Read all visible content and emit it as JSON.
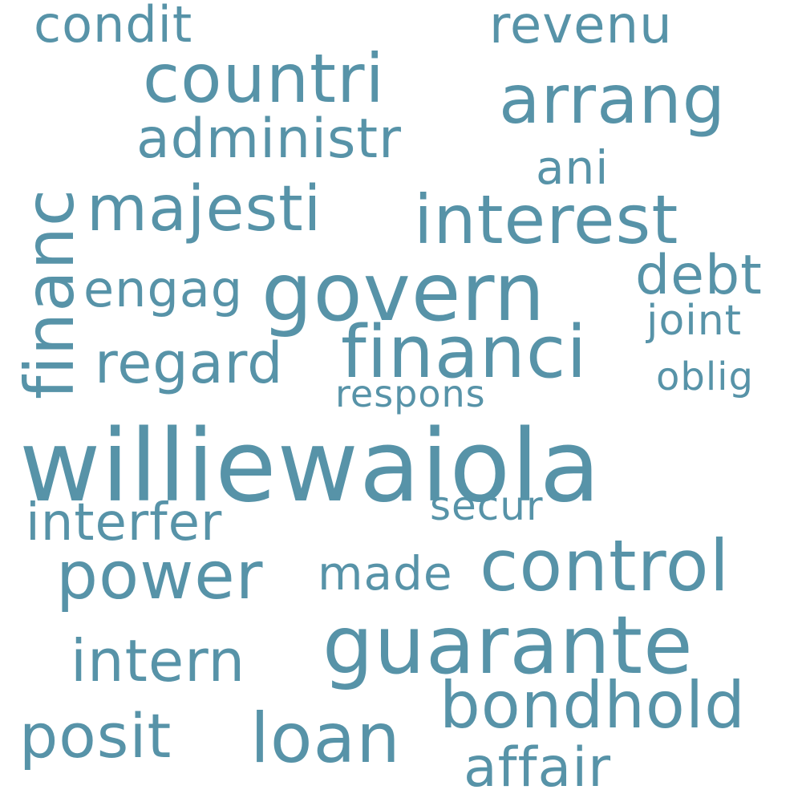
{
  "word_color": "#5793A8",
  "background_color": "#FFFFFF",
  "words": [
    {
      "text": "williewaiola"
    },
    {
      "text": "govern"
    },
    {
      "text": "guarante"
    },
    {
      "text": "financi"
    },
    {
      "text": "interest"
    },
    {
      "text": "control"
    },
    {
      "text": "countri"
    },
    {
      "text": "arrang"
    },
    {
      "text": "financ"
    },
    {
      "text": "majesti"
    },
    {
      "text": "loan"
    },
    {
      "text": "bondhold"
    },
    {
      "text": "power"
    },
    {
      "text": "posit"
    },
    {
      "text": "administr"
    },
    {
      "text": "regard"
    },
    {
      "text": "intern"
    },
    {
      "text": "affair"
    },
    {
      "text": "revenu"
    },
    {
      "text": "debt"
    },
    {
      "text": "interfer"
    },
    {
      "text": "made"
    },
    {
      "text": "condit"
    },
    {
      "text": "engag"
    },
    {
      "text": "ani"
    },
    {
      "text": "joint"
    },
    {
      "text": "oblig"
    },
    {
      "text": "secur"
    },
    {
      "text": "respons"
    }
  ]
}
